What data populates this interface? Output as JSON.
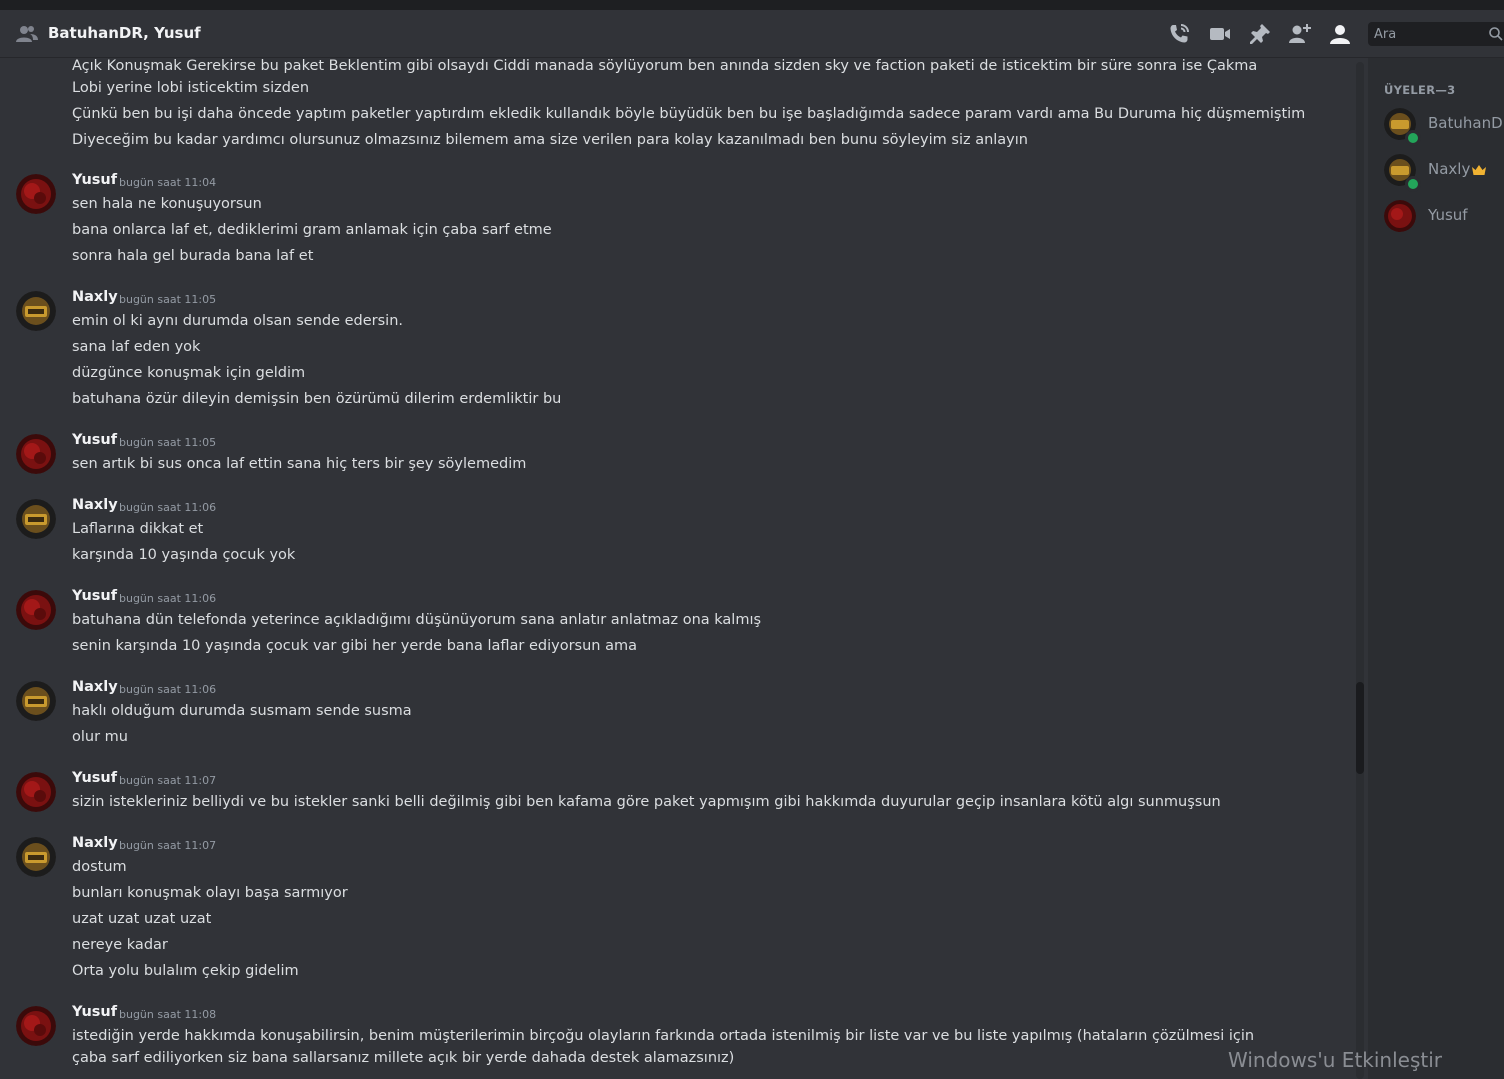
{
  "header": {
    "title": "BatuhanDR, Yusuf",
    "search_placeholder": "Ara"
  },
  "intro_lines": [
    "Açık Konuşmak Gerekirse bu paket Beklentim gibi olsaydı Ciddi manada söylüyorum ben anında sizden sky ve faction paketi de isticektim bir süre sonra ise Çakma Lobi yerine lobi isticektim sizden",
    "Çünkü ben bu işi daha öncede yaptım paketler yaptırdım ekledik kullandık böyle büyüdük ben bu işe başladığımda sadece param vardı ama Bu Duruma hiç düşmemiştim",
    "Diyeceğim bu kadar yardımcı olursunuz olmazsınız bilemem ama size verilen para kolay kazanılmadı ben bunu söyleyim siz anlayın"
  ],
  "messages": [
    {
      "author": "Yusuf",
      "time": "bugün saat 11:04",
      "lines": [
        "sen hala ne konuşuyorsun",
        "bana onlarca laf et, dediklerimi gram anlamak için çaba sarf etme",
        "sonra hala gel burada bana laf et"
      ]
    },
    {
      "author": "Naxly",
      "time": "bugün saat 11:05",
      "lines": [
        "emin ol ki aynı durumda olsan sende edersin.",
        "sana laf eden yok",
        "düzgünce konuşmak için geldim",
        "batuhana özür dileyin demişsin ben özürümü dilerim erdemliktir bu"
      ]
    },
    {
      "author": "Yusuf",
      "time": "bugün saat 11:05",
      "lines": [
        "sen artık bi sus onca laf ettin sana hiç ters bir şey söylemedim"
      ]
    },
    {
      "author": "Naxly",
      "time": "bugün saat 11:06",
      "lines": [
        "Laflarına dikkat et",
        "karşında 10 yaşında çocuk yok"
      ]
    },
    {
      "author": "Yusuf",
      "time": "bugün saat 11:06",
      "lines": [
        "batuhana dün telefonda yeterince açıkladığımı düşünüyorum sana anlatır anlatmaz ona kalmış",
        "senin karşında 10 yaşında çocuk var gibi her yerde bana laflar ediyorsun ama"
      ]
    },
    {
      "author": "Naxly",
      "time": "bugün saat 11:06",
      "lines": [
        "haklı olduğum durumda susmam sende susma",
        "olur mu"
      ]
    },
    {
      "author": "Yusuf",
      "time": "bugün saat 11:07",
      "lines": [
        "sizin istekleriniz belliydi ve bu istekler sanki belli değilmiş gibi ben kafama göre paket yapmışım gibi hakkımda duyurular geçip insanlara kötü algı sunmuşsun"
      ]
    },
    {
      "author": "Naxly",
      "time": "bugün saat 11:07",
      "lines": [
        "dostum",
        "bunları konuşmak olayı başa sarmıyor",
        "uzat uzat uzat uzat",
        "nereye kadar",
        "Orta yolu bulalım çekip gidelim"
      ]
    },
    {
      "author": "Yusuf",
      "time": "bugün saat 11:08",
      "lines": [
        "istediğin yerde hakkımda konuşabilirsin, benim müşterilerimin birçoğu olayların farkında ortada istenilmiş bir liste var ve bu liste yapılmış (hataların çözülmesi için çaba sarf ediliyorken siz bana sallarsanız millete açık bir yerde dahada destek alamazsınız)"
      ]
    }
  ],
  "members": {
    "heading": "ÜYELER—3",
    "list": [
      {
        "name": "BatuhanDR",
        "status": "online"
      },
      {
        "name": "Naxly",
        "status": "online",
        "owner": true
      },
      {
        "name": "Yusuf",
        "status": "offline"
      }
    ]
  },
  "watermark": "Windows'u Etkinleştir",
  "colors": {
    "chat_bg": "#313338",
    "sidebar_bg": "#2b2d31",
    "online": "#23a55a",
    "crown": "#f0b232"
  }
}
